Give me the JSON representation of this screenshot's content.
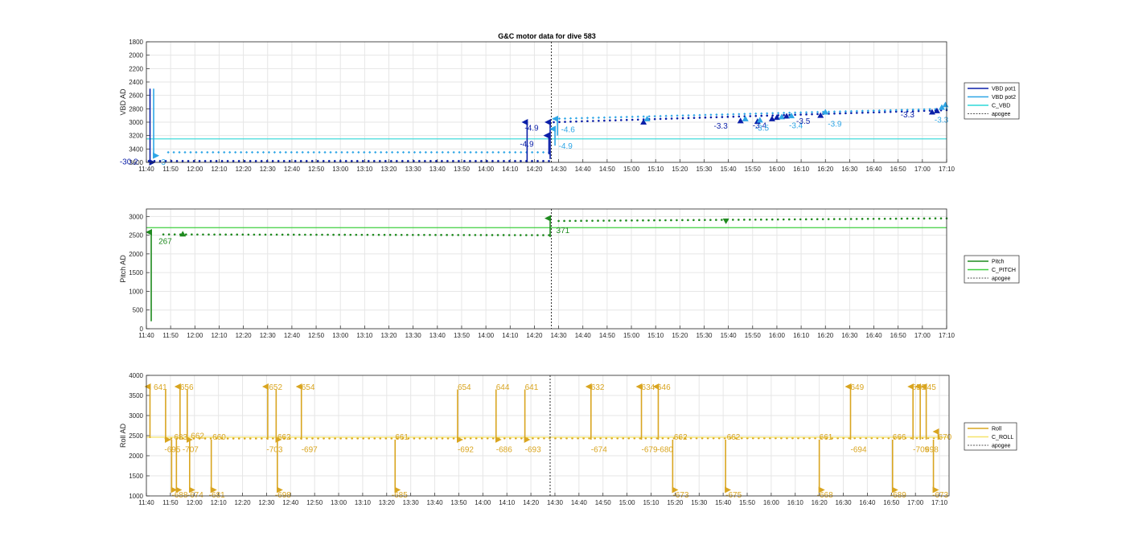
{
  "chart_data": [
    {
      "type": "scatter",
      "title": "G&C motor data for dive 583",
      "ylabel": "VBD AD",
      "ylim": [
        1800,
        3600
      ],
      "y_reversed": true,
      "yticks": [
        "1800",
        "2000",
        "2200",
        "2400",
        "2600",
        "2800",
        "3000",
        "3200",
        "3400",
        "3600"
      ],
      "xticks": [
        "11:40",
        "11:50",
        "12:00",
        "12:10",
        "12:20",
        "12:30",
        "12:40",
        "12:50",
        "13:00",
        "13:10",
        "13:20",
        "13:30",
        "13:40",
        "13:50",
        "14:00",
        "14:10",
        "14:20",
        "14:30",
        "14:40",
        "14:50",
        "15:00",
        "15:10",
        "15:20",
        "15:30",
        "15:40",
        "15:50",
        "16:00",
        "16:10",
        "16:20",
        "16:30",
        "16:40",
        "16:50",
        "17:00",
        "17:10"
      ],
      "xlim_minutes": [
        0,
        330
      ],
      "apogee_minute": 167,
      "grid": true,
      "legend_position": "right",
      "series": [
        {
          "name": "VBD pot1",
          "color": "#0b1fa8",
          "style": "dots",
          "segments": [
            {
              "x0": 1,
              "x1": 166,
              "y0": 3580,
              "y1": 3580
            },
            {
              "x0": 168,
              "x1": 330,
              "y0": 3000,
              "y1": 2820
            }
          ]
        },
        {
          "name": "VBD pot2",
          "color": "#2fa6e6",
          "style": "dots",
          "segments": [
            {
              "x0": 9,
              "x1": 166,
              "y0": 3450,
              "y1": 3450
            },
            {
              "x0": 168,
              "x1": 330,
              "y0": 2950,
              "y1": 2800
            }
          ]
        },
        {
          "name": "C_VBD",
          "color": "#2fd9d9",
          "style": "line",
          "segments": [
            {
              "x0": 0,
              "x1": 330,
              "y0": 3250,
              "y1": 3250
            }
          ]
        },
        {
          "name": "apogee",
          "color": "#555555",
          "style": "dotted-vline",
          "segments": []
        }
      ],
      "arrows": [
        {
          "x": 1.5,
          "y0": 2500,
          "y1": 3600,
          "color": "#0b1fa8"
        },
        {
          "x": 3,
          "y0": 2500,
          "y1": 3500,
          "color": "#2fa6e6"
        },
        {
          "x": 157,
          "y0": 3600,
          "y1": 3000,
          "color": "#0b1fa8"
        },
        {
          "x": 166,
          "y0": 3480,
          "y1": 3200,
          "color": "#0b1fa8"
        },
        {
          "x": 166.5,
          "y0": 3550,
          "y1": 3000,
          "color": "#0b1fa8"
        },
        {
          "x": 168.5,
          "y0": 3350,
          "y1": 3100,
          "color": "#2fa6e6"
        },
        {
          "x": 169.5,
          "y0": 3200,
          "y1": 2950,
          "color": "#2fa6e6"
        }
      ],
      "markers": [
        {
          "x": 205,
          "y": 3000,
          "dir": "up",
          "color": "#0b1fa8"
        },
        {
          "x": 206.5,
          "y": 2950,
          "dir": "up",
          "color": "#2fa6e6"
        },
        {
          "x": 245,
          "y": 2980,
          "dir": "up",
          "color": "#0b1fa8"
        },
        {
          "x": 247,
          "y": 2950,
          "dir": "up",
          "color": "#2fa6e6"
        },
        {
          "x": 252,
          "y": 2990,
          "dir": "up",
          "color": "#0b1fa8"
        },
        {
          "x": 253,
          "y": 2970,
          "dir": "up",
          "color": "#2fa6e6"
        },
        {
          "x": 258,
          "y": 2950,
          "dir": "up",
          "color": "#0b1fa8"
        },
        {
          "x": 260,
          "y": 2930,
          "dir": "up",
          "color": "#0b1fa8"
        },
        {
          "x": 262,
          "y": 2920,
          "dir": "up",
          "color": "#2fa6e6"
        },
        {
          "x": 264,
          "y": 2910,
          "dir": "up",
          "color": "#0b1fa8"
        },
        {
          "x": 266,
          "y": 2905,
          "dir": "up",
          "color": "#2fa6e6"
        },
        {
          "x": 278,
          "y": 2900,
          "dir": "up",
          "color": "#0b1fa8"
        },
        {
          "x": 280,
          "y": 2850,
          "dir": "up",
          "color": "#2fa6e6"
        },
        {
          "x": 324,
          "y": 2850,
          "dir": "up",
          "color": "#0b1fa8"
        },
        {
          "x": 326,
          "y": 2830,
          "dir": "up",
          "color": "#0b1fa8"
        },
        {
          "x": 328,
          "y": 2780,
          "dir": "up",
          "color": "#2fa6e6"
        },
        {
          "x": 329.5,
          "y": 2740,
          "dir": "up",
          "color": "#2fa6e6"
        }
      ],
      "annotations": [
        {
          "text": "-30.2",
          "x": -11,
          "y": 3580,
          "color": "#0b1fa8"
        },
        {
          "text": "-3",
          "x": 5,
          "y": 3585,
          "color": "#2fa6e6"
        },
        {
          "text": "-4.9",
          "x": 156,
          "y": 3080,
          "color": "#0b1fa8"
        },
        {
          "text": "-4.6",
          "x": 171,
          "y": 3100,
          "color": "#2fa6e6"
        },
        {
          "text": "-4.9",
          "x": 154,
          "y": 3320,
          "color": "#0b1fa8"
        },
        {
          "text": "-4.9",
          "x": 170,
          "y": 3350,
          "color": "#2fa6e6"
        },
        {
          "text": "-3.3",
          "x": 234,
          "y": 3050,
          "color": "#0b1fa8"
        },
        {
          "text": "-3.4",
          "x": 250,
          "y": 3040,
          "color": "#0b1fa8"
        },
        {
          "text": "-3.5",
          "x": 251,
          "y": 3080,
          "color": "#2fa6e6"
        },
        {
          "text": "-3.4",
          "x": 265,
          "y": 3040,
          "color": "#2fa6e6"
        },
        {
          "text": "-3.5",
          "x": 268,
          "y": 2975,
          "color": "#0b1fa8"
        },
        {
          "text": "-3.9",
          "x": 281,
          "y": 3015,
          "color": "#2fa6e6"
        },
        {
          "text": "-3.3",
          "x": 311,
          "y": 2880,
          "color": "#0b1fa8"
        },
        {
          "text": "-3.3",
          "x": 325,
          "y": 2960,
          "color": "#2fa6e6"
        }
      ]
    },
    {
      "type": "scatter",
      "ylabel": "Pitch AD",
      "ylim": [
        0,
        3200
      ],
      "yticks": [
        "0",
        "500",
        "1000",
        "1500",
        "2000",
        "2500",
        "3000"
      ],
      "xticks": [
        "11:40",
        "11:50",
        "12:00",
        "12:10",
        "12:20",
        "12:30",
        "12:40",
        "12:50",
        "13:00",
        "13:10",
        "13:20",
        "13:30",
        "13:40",
        "13:50",
        "14:00",
        "14:10",
        "14:20",
        "14:30",
        "14:40",
        "14:50",
        "15:00",
        "15:10",
        "15:20",
        "15:30",
        "15:40",
        "15:50",
        "16:00",
        "16:10",
        "16:20",
        "16:30",
        "16:40",
        "16:50",
        "17:00",
        "17:10"
      ],
      "xlim_minutes": [
        0,
        330
      ],
      "apogee_minute": 167,
      "grid": true,
      "legend_position": "right",
      "series": [
        {
          "name": "Pitch",
          "color": "#1f8a1f",
          "style": "dots",
          "segments": [
            {
              "x0": 7,
              "x1": 166,
              "y0": 2520,
              "y1": 2500
            },
            {
              "x0": 170,
              "x1": 330,
              "y0": 2880,
              "y1": 2950
            }
          ]
        },
        {
          "name": "C_PITCH",
          "color": "#3fcf3f",
          "style": "line",
          "segments": [
            {
              "x0": 0,
              "x1": 330,
              "y0": 2700,
              "y1": 2700
            }
          ]
        },
        {
          "name": "apogee",
          "color": "#555555",
          "style": "dotted-vline",
          "segments": []
        }
      ],
      "arrows": [
        {
          "x": 2,
          "y0": 200,
          "y1": 2580,
          "color": "#1f8a1f"
        },
        {
          "x": 166.5,
          "y0": 2450,
          "y1": 2950,
          "color": "#1f8a1f"
        }
      ],
      "markers": [
        {
          "x": 15,
          "y": 2530,
          "dir": "up",
          "color": "#1f8a1f"
        },
        {
          "x": 239,
          "y": 2880,
          "dir": "down",
          "color": "#1f8a1f"
        }
      ],
      "annotations": [
        {
          "text": "267",
          "x": 5,
          "y": 2350,
          "color": "#1f8a1f"
        },
        {
          "text": "371",
          "x": 169,
          "y": 2640,
          "color": "#1f8a1f"
        }
      ]
    },
    {
      "type": "scatter",
      "ylabel": "Roll AD",
      "ylim": [
        1000,
        4000
      ],
      "yticks": [
        "1000",
        "1500",
        "2000",
        "2500",
        "3000",
        "3500",
        "4000"
      ],
      "xticks": [
        "11:40",
        "11:50",
        "12:00",
        "12:10",
        "12:20",
        "12:30",
        "12:40",
        "12:50",
        "13:00",
        "13:10",
        "13:20",
        "13:30",
        "13:40",
        "13:50",
        "14:00",
        "14:10",
        "14:20",
        "14:30",
        "14:40",
        "14:50",
        "15:00",
        "15:10",
        "15:20",
        "15:30",
        "15:40",
        "15:50",
        "16:00",
        "16:10",
        "16:20",
        "16:30",
        "16:40",
        "16:50",
        "17:00",
        "17:10"
      ],
      "xlim_minutes": [
        0,
        334
      ],
      "apogee_minute": 168,
      "grid": true,
      "legend_position": "right",
      "series": [
        {
          "name": "Roll",
          "color": "#d9a520",
          "style": "dots",
          "segments": [
            {
              "x0": 8,
              "x1": 330,
              "y0": 2430,
              "y1": 2440
            }
          ]
        },
        {
          "name": "C_ROLL",
          "color": "#f5e36a",
          "style": "line",
          "segments": [
            {
              "x0": 0,
              "x1": 334,
              "y0": 2460,
              "y1": 2460
            }
          ]
        },
        {
          "name": "apogee",
          "color": "#555555",
          "style": "dotted-vline",
          "segments": []
        }
      ],
      "arrows": [
        {
          "x": 1.5,
          "y0": 2440,
          "y1": 3720,
          "color": "#d9a520"
        },
        {
          "x": 8,
          "y0": 3650,
          "y1": 2400,
          "color": "#d9a520"
        },
        {
          "x": 10.5,
          "y0": 2400,
          "y1": 1150,
          "color": "#d9a520"
        },
        {
          "x": 12.5,
          "y0": 2400,
          "y1": 1150,
          "color": "#d9a520"
        },
        {
          "x": 14,
          "y0": 2400,
          "y1": 3720,
          "color": "#d9a520"
        },
        {
          "x": 17,
          "y0": 3650,
          "y1": 2400,
          "color": "#d9a520"
        },
        {
          "x": 18,
          "y0": 2400,
          "y1": 1150,
          "color": "#d9a520"
        },
        {
          "x": 27,
          "y0": 2400,
          "y1": 1150,
          "color": "#d9a520"
        },
        {
          "x": 50.5,
          "y0": 2400,
          "y1": 3720,
          "color": "#d9a520"
        },
        {
          "x": 54,
          "y0": 3650,
          "y1": 2400,
          "color": "#d9a520"
        },
        {
          "x": 54.5,
          "y0": 2400,
          "y1": 1150,
          "color": "#d9a520"
        },
        {
          "x": 64.5,
          "y0": 2400,
          "y1": 3720,
          "color": "#d9a520"
        },
        {
          "x": 103.5,
          "y0": 2400,
          "y1": 1150,
          "color": "#d9a520"
        },
        {
          "x": 129.5,
          "y0": 3650,
          "y1": 2400,
          "color": "#d9a520"
        },
        {
          "x": 145.5,
          "y0": 3650,
          "y1": 2400,
          "color": "#d9a520"
        },
        {
          "x": 157.5,
          "y0": 3650,
          "y1": 2400,
          "color": "#d9a520"
        },
        {
          "x": 185,
          "y0": 2400,
          "y1": 3720,
          "color": "#d9a520"
        },
        {
          "x": 206,
          "y0": 2400,
          "y1": 3720,
          "color": "#d9a520"
        },
        {
          "x": 213,
          "y0": 2400,
          "y1": 3720,
          "color": "#d9a520"
        },
        {
          "x": 219,
          "y0": 2400,
          "y1": 1150,
          "color": "#d9a520"
        },
        {
          "x": 241,
          "y0": 2400,
          "y1": 1150,
          "color": "#d9a520"
        },
        {
          "x": 280,
          "y0": 2400,
          "y1": 1150,
          "color": "#d9a520"
        },
        {
          "x": 293,
          "y0": 2400,
          "y1": 3720,
          "color": "#d9a520"
        },
        {
          "x": 310.5,
          "y0": 2400,
          "y1": 1150,
          "color": "#d9a520"
        },
        {
          "x": 319,
          "y0": 2400,
          "y1": 3720,
          "color": "#d9a520"
        },
        {
          "x": 322,
          "y0": 2400,
          "y1": 3720,
          "color": "#d9a520"
        },
        {
          "x": 324.5,
          "y0": 2400,
          "y1": 3720,
          "color": "#d9a520"
        },
        {
          "x": 327.5,
          "y0": 2400,
          "y1": 1150,
          "color": "#d9a520"
        },
        {
          "x": 329.5,
          "y0": 2400,
          "y1": 2600,
          "color": "#d9a520"
        }
      ],
      "markers": [],
      "annotations": [
        {
          "text": "641",
          "x": 3,
          "y": 3720
        },
        {
          "text": "-695",
          "x": 7.5,
          "y": 2170
        },
        {
          "text": "-688",
          "x": 10.5,
          "y": 1040
        },
        {
          "text": "683",
          "x": 11.5,
          "y": 2480
        },
        {
          "text": "-707",
          "x": 15,
          "y": 2170
        },
        {
          "text": "662",
          "x": 18.5,
          "y": 2510
        },
        {
          "text": "-674",
          "x": 17,
          "y": 1040
        },
        {
          "text": "656",
          "x": 14,
          "y": 3720
        },
        {
          "text": "660",
          "x": 27.5,
          "y": 2480
        },
        {
          "text": "-681",
          "x": 26,
          "y": 1040
        },
        {
          "text": "652",
          "x": 51,
          "y": 3720
        },
        {
          "text": "662",
          "x": 54.5,
          "y": 2480
        },
        {
          "text": "-703",
          "x": 50,
          "y": 2170
        },
        {
          "text": "-698",
          "x": 53.5,
          "y": 1040
        },
        {
          "text": "654",
          "x": 64.5,
          "y": 3720
        },
        {
          "text": "-697",
          "x": 64.5,
          "y": 2170
        },
        {
          "text": "661",
          "x": 103.5,
          "y": 2480
        },
        {
          "text": "-685",
          "x": 102,
          "y": 1040
        },
        {
          "text": "654",
          "x": 129.5,
          "y": 3720
        },
        {
          "text": "-692",
          "x": 129.5,
          "y": 2170
        },
        {
          "text": "644",
          "x": 145.5,
          "y": 3720
        },
        {
          "text": "-686",
          "x": 145.5,
          "y": 2170
        },
        {
          "text": "641",
          "x": 157.5,
          "y": 3720
        },
        {
          "text": "-693",
          "x": 157.5,
          "y": 2170
        },
        {
          "text": "632",
          "x": 185,
          "y": 3720
        },
        {
          "text": "-674",
          "x": 185,
          "y": 2170
        },
        {
          "text": "634",
          "x": 206,
          "y": 3720
        },
        {
          "text": "-679",
          "x": 206,
          "y": 2170
        },
        {
          "text": "646",
          "x": 212.5,
          "y": 3720
        },
        {
          "text": "-680",
          "x": 212.5,
          "y": 2170
        },
        {
          "text": "662",
          "x": 219.5,
          "y": 2480
        },
        {
          "text": "-673",
          "x": 219,
          "y": 1040
        },
        {
          "text": "662",
          "x": 241.5,
          "y": 2480
        },
        {
          "text": "-675",
          "x": 241,
          "y": 1040
        },
        {
          "text": "661",
          "x": 280,
          "y": 2480
        },
        {
          "text": "-668",
          "x": 279,
          "y": 1040
        },
        {
          "text": "649",
          "x": 293,
          "y": 3720
        },
        {
          "text": "-694",
          "x": 293,
          "y": 2170
        },
        {
          "text": "666",
          "x": 310.5,
          "y": 2480
        },
        {
          "text": "-689",
          "x": 309.5,
          "y": 1040
        },
        {
          "text": "656",
          "x": 318.5,
          "y": 3720
        },
        {
          "text": "645",
          "x": 323,
          "y": 3720
        },
        {
          "text": "-709",
          "x": 319,
          "y": 2170
        },
        {
          "text": "698",
          "x": 324,
          "y": 2170
        },
        {
          "text": "670",
          "x": 329.5,
          "y": 2480
        },
        {
          "text": "-673",
          "x": 327,
          "y": 1040
        }
      ]
    }
  ]
}
